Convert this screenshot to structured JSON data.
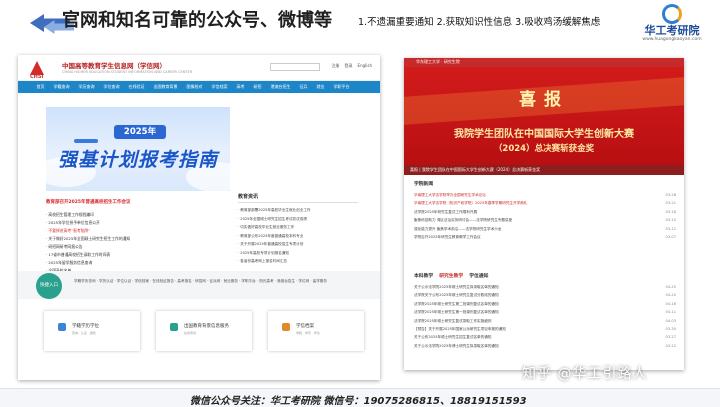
{
  "slide": {
    "title": "官网和知名可靠的公众号、微博等",
    "note": "1.不遗漏重要通知 2.获取知识性信息 3.吸收鸡汤缓解焦虑"
  },
  "logo": {
    "name": "华工考研院",
    "url": "www.huagongkaoyan.com"
  },
  "chsi": {
    "logo_text": "CHSI",
    "site_name": "中国高等教育学生信息网（学信网）",
    "site_sub": "CHINA HIGHER EDUCATION STUDENT INFORMATION AND CAREER CENTER",
    "top_links": [
      "注册",
      "登录",
      "English"
    ],
    "nav": [
      "首页",
      "学籍查询",
      "学历查询",
      "学位查询",
      "在线验证",
      "出国教育背景",
      "图像校对",
      "学信档案",
      "高考",
      "研招",
      "港澳台招生",
      "征兵",
      "就业",
      "学职平台"
    ],
    "banner_year": "2025年",
    "banner_title": "强基计划报考指南",
    "news_head": "教育部召开2025年普通高校招生工作会议",
    "news_lines": [
      "· 高校招生管理工作规程编印",
      "· 2025年学位授予单位信息公开",
      "· 不要掉进高考“报考陷阱”",
      "· 关于做好2025年全国硕士研究生招生工作的通知",
      "· 研招网研考网报公告",
      "· 17省市普通高校招生录取工作时间表",
      "· 2025年留学服务信息查询",
      "· 全国高校名单"
    ],
    "info_title": "教育资讯",
    "info_lines": [
      "· 教育部部署2025年高校毕业生就业创业工作",
      "· 2025年全国硕士研究生招生考试初试成绩",
      "· 切实做好高校毕业生就业服务工作",
      "· 教育部公布2025年度普通高校本科专业",
      "· 关于开展2025年普通高校招生专项计划",
      "· 2025年高校专项计划报名通知",
      "· 各省份高考网上报名时间汇总"
    ],
    "services_label": "快捷入口",
    "services_text": "学籍学历查询 · 学历认证 · 学位认证 · 学信档案 · 在线验证报告 · 高考报名 · 研招网 · 征兵网 · 就业服务 · 学职平台 · 阳光高考 · 港澳台招生 · 学位网 · 留学服务",
    "cards": [
      {
        "label": "学籍学历学位",
        "sub": "查询 · 认证 · 报告"
      },
      {
        "label": "出国教育背景信息服务",
        "sub": "在线申请"
      },
      {
        "label": "学信档案",
        "sub": "学籍 · 学历 · 学位"
      }
    ]
  },
  "univ": {
    "bar_text": "华东理工大学 · 研究生院",
    "xibao": "喜报",
    "headline1": "我院学生团队在中国国际大学生创新大赛",
    "headline2": "（2024）总决赛斩获金奖",
    "caption": "喜报 | 我院学生团队在中国国际大学生创新大赛（2024）总决赛斩获金奖",
    "news_title": "学院新闻",
    "news": [
      {
        "text": "华南理工大学法学院举办全国研究生学术论坛",
        "date": "03-28",
        "hl": true
      },
      {
        "text": "华南理工大学法学院（知识产权学院）2025年春季学期研究生开学典礼",
        "date": "03-21",
        "hl": true
      },
      {
        "text": "法学院2025年研究生复试工作顺利开展",
        "date": "03-18"
      },
      {
        "text": "聚焦科技助力  湾区法治实务研讨会——法学院研究生专题讲座",
        "date": "03-15"
      },
      {
        "text": "强化能力提升 聚焦学术前沿——法学院研究生学术沙龙",
        "date": "03-12"
      },
      {
        "text": "学院召开2025年研究生教育教学工作会议",
        "date": "03-07"
      }
    ],
    "tabs": [
      "本科教学",
      "研究生教学",
      "学位通知"
    ],
    "notices": [
      {
        "text": "关于公示法学院2025年硕士研究生拟录取名单的通知",
        "date": "04-25"
      },
      {
        "text": "法学院关于公布2025年硕士研究生复试分数线的通知",
        "date": "04-20"
      },
      {
        "text": "法学院2025年硕士研究生第二批调剂复试名单的通知",
        "date": "04-16"
      },
      {
        "text": "法学院2025年硕士研究生第一批调剂复试名单的通知",
        "date": "04-11"
      },
      {
        "text": "法学院2025年硕士研究生复试录取工作实施细则",
        "date": "04-03"
      },
      {
        "text": "【预告】关于开展2025年国家公派研究生项目申报的通知",
        "date": "03-30"
      },
      {
        "text": "关于公布2025年硕士研究生招生复试名单的通知",
        "date": "03-27"
      },
      {
        "text": "关于公示法学院2025年博士研究生拟录取名单的通知",
        "date": "03-22"
      }
    ]
  },
  "watermark": "知乎 @华工引路人",
  "footer": "微信公众号关注：华工考研院       微信号：19075286815、18819151593"
}
